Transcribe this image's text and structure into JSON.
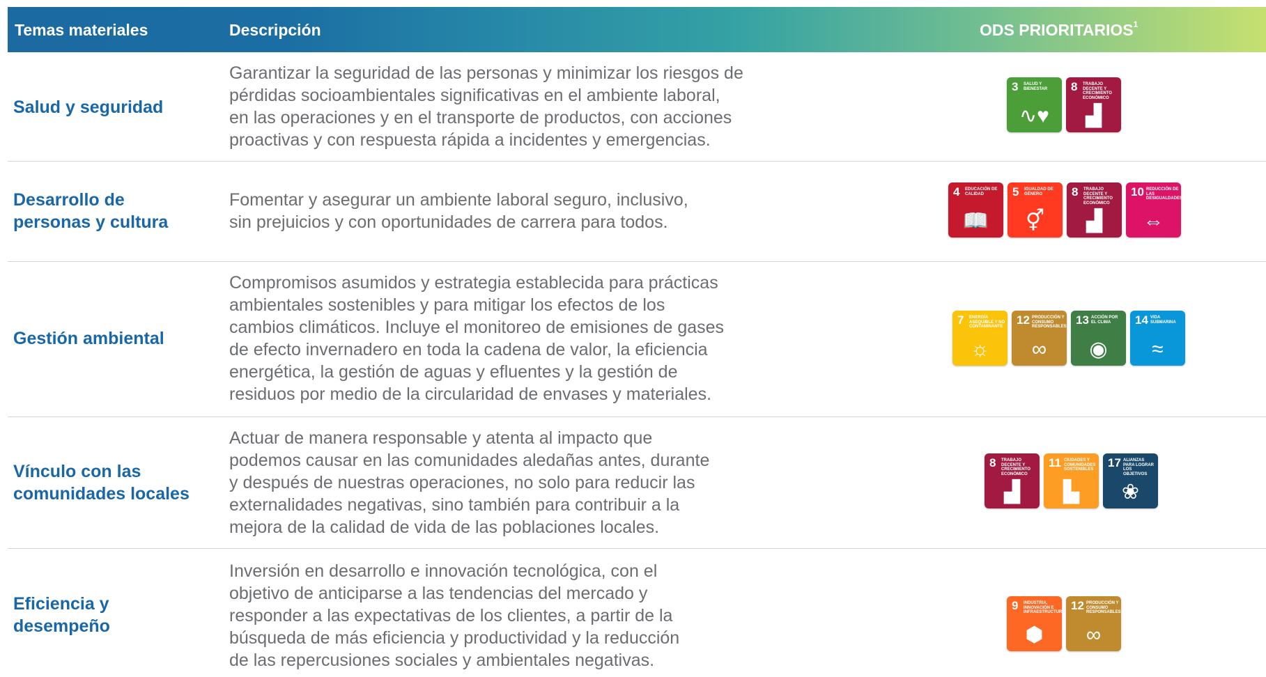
{
  "header": {
    "topics": "Temas materiales",
    "description": "Descripción",
    "ods": "ODS PRIORITARIOS",
    "ods_sup": "1"
  },
  "rows": [
    {
      "topic": [
        "Salud y seguridad"
      ],
      "description": [
        "Garantizar la seguridad de las personas y minimizar los riesgos de",
        "pérdidas socioambientales significativas en el ambiente laboral,",
        "en las operaciones y en el transporte de productos, con acciones",
        "proactivas y con respuesta rápida a incidentes y emergencias."
      ],
      "sdgs": [
        {
          "num": "3",
          "label": "SALUD Y BIENESTAR",
          "color": "#4c9f38",
          "icon": "heartbeat-icon",
          "glyph": "∿♥"
        },
        {
          "num": "8",
          "label": "TRABAJO DECENTE Y CRECIMIENTO ECONÓMICO",
          "color": "#a21942",
          "icon": "growth-chart-icon",
          "glyph": "▟"
        }
      ]
    },
    {
      "topic": [
        "Desarrollo de",
        "personas y cultura"
      ],
      "description": [
        "Fomentar y asegurar un ambiente laboral seguro, inclusivo,",
        "sin prejuicios y con oportunidades de carrera para todos."
      ],
      "sdgs": [
        {
          "num": "4",
          "label": "EDUCACIÓN DE CALIDAD",
          "color": "#c5192d",
          "icon": "book-pencil-icon",
          "glyph": "📖"
        },
        {
          "num": "5",
          "label": "IGUALDAD DE GÉNERO",
          "color": "#ff3a21",
          "icon": "gender-equality-icon",
          "glyph": "⚥"
        },
        {
          "num": "8",
          "label": "TRABAJO DECENTE Y CRECIMIENTO ECONÓMICO",
          "color": "#a21942",
          "icon": "growth-chart-icon",
          "glyph": "▟"
        },
        {
          "num": "10",
          "label": "REDUCCIÓN DE LAS DESIGUALDADES",
          "color": "#dd1367",
          "icon": "equality-arrows-icon",
          "glyph": "⇔"
        }
      ]
    },
    {
      "topic": [
        "Gestión ambiental"
      ],
      "description": [
        "Compromisos asumidos y estrategia establecida para prácticas",
        "ambientales sostenibles y para mitigar los efectos de los",
        "cambios climáticos. Incluye el monitoreo de emisiones de gases",
        "de efecto invernadero en toda la cadena de valor, la eficiencia",
        "energética, la gestión de aguas y efluentes y la gestión de",
        "residuos por medio de la circularidad de envases y materiales."
      ],
      "sdgs": [
        {
          "num": "7",
          "label": "ENERGÍA ASEQUIBLE Y NO CONTAMINANTE",
          "color": "#fcc30b",
          "icon": "sun-power-icon",
          "glyph": "☼"
        },
        {
          "num": "12",
          "label": "PRODUCCIÓN Y CONSUMO RESPONSABLES",
          "color": "#bf8b2e",
          "icon": "infinity-icon",
          "glyph": "∞"
        },
        {
          "num": "13",
          "label": "ACCIÓN POR EL CLIMA",
          "color": "#3f7e44",
          "icon": "eye-globe-icon",
          "glyph": "◉"
        },
        {
          "num": "14",
          "label": "VIDA SUBMARINA",
          "color": "#0a97d9",
          "icon": "fish-waves-icon",
          "glyph": "≈"
        }
      ]
    },
    {
      "topic": [
        "Vínculo con las",
        "comunidades locales"
      ],
      "description": [
        "Actuar de manera responsable y atenta al impacto que",
        "podemos causar en las comunidades aledañas antes, durante",
        "y después de nuestras operaciones, no solo para reducir las",
        "externalidades negativas, sino también para contribuir a la",
        "mejora de la calidad de vida de las poblaciones locales."
      ],
      "sdgs": [
        {
          "num": "8",
          "label": "TRABAJO DECENTE Y CRECIMIENTO ECONÓMICO",
          "color": "#a21942",
          "icon": "growth-chart-icon",
          "glyph": "▟"
        },
        {
          "num": "11",
          "label": "CIUDADES Y COMUNIDADES SOSTENIBLES",
          "color": "#fd9d24",
          "icon": "city-buildings-icon",
          "glyph": "▙"
        },
        {
          "num": "17",
          "label": "ALIANZAS PARA LOGRAR LOS OBJETIVOS",
          "color": "#19486a",
          "icon": "flower-rings-icon",
          "glyph": "❀"
        }
      ]
    },
    {
      "topic": [
        "Eficiencia y",
        "desempeño"
      ],
      "description": [
        "Inversión en desarrollo e innovación tecnológica, con el",
        "objetivo de anticiparse a las tendencias del mercado y",
        "responder a las expectativas de los clientes, a partir de la",
        "búsqueda de más eficiencia y productividad y la reducción",
        "de las repercusiones sociales y ambientales negativas."
      ],
      "sdgs": [
        {
          "num": "9",
          "label": "INDUSTRIA, INNOVACIÓN E INFRAESTRUCTURA",
          "color": "#fd6925",
          "icon": "cubes-icon",
          "glyph": "⬢"
        },
        {
          "num": "12",
          "label": "PRODUCCIÓN Y CONSUMO RESPONSABLES",
          "color": "#bf8b2e",
          "icon": "infinity-icon",
          "glyph": "∞"
        }
      ]
    }
  ]
}
